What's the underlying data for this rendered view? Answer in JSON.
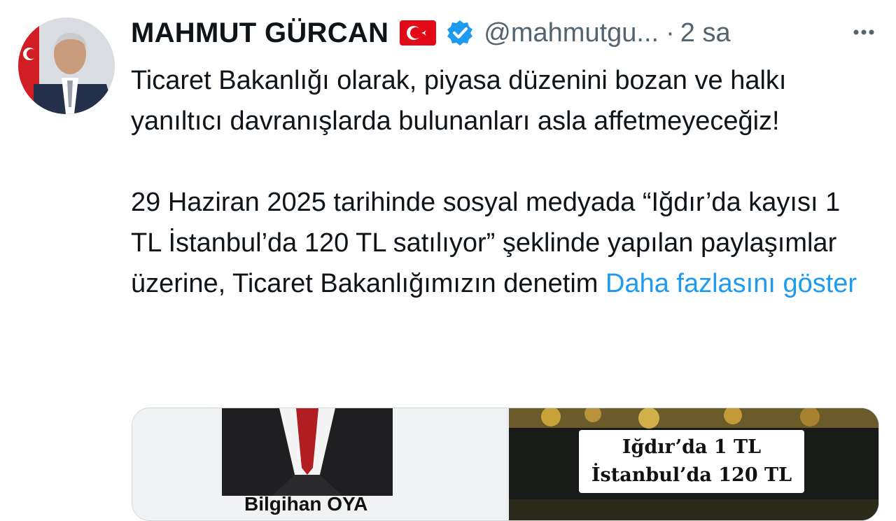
{
  "author": {
    "name": "MAHMUT GÜRCAN",
    "handle": "@mahmutgu...",
    "separator": "·",
    "time": "2 sa",
    "flag_icon": "turkey-flag-icon",
    "verified_icon": "verified-badge-icon"
  },
  "tweet": {
    "paragraph1": "Ticaret Bakanlığı olarak, piyasa düzenini bozan ve halkı yanıltıcı davranışlarda bulunanları asla affetmeyeceğiz!",
    "paragraph2": "29 Haziran 2025 tarihinde sosyal medyada “Iğdır’da kayısı 1 TL İstanbul’da 120 TL satılıyor” şeklinde yapılan paylaşımlar üzerine, Ticaret Bakanlığımızın denetim",
    "show_more": "Daha fazlasını göster"
  },
  "media": {
    "left_caption": "Bilgihan OYA",
    "right_line1": "Iğdır’da 1 TL",
    "right_line2": "İstanbul’da 120 TL"
  },
  "colors": {
    "link": "#1d9bf0",
    "secondary_text": "#536471",
    "verified": "#1d9bf0",
    "flag": "#e30a17"
  }
}
